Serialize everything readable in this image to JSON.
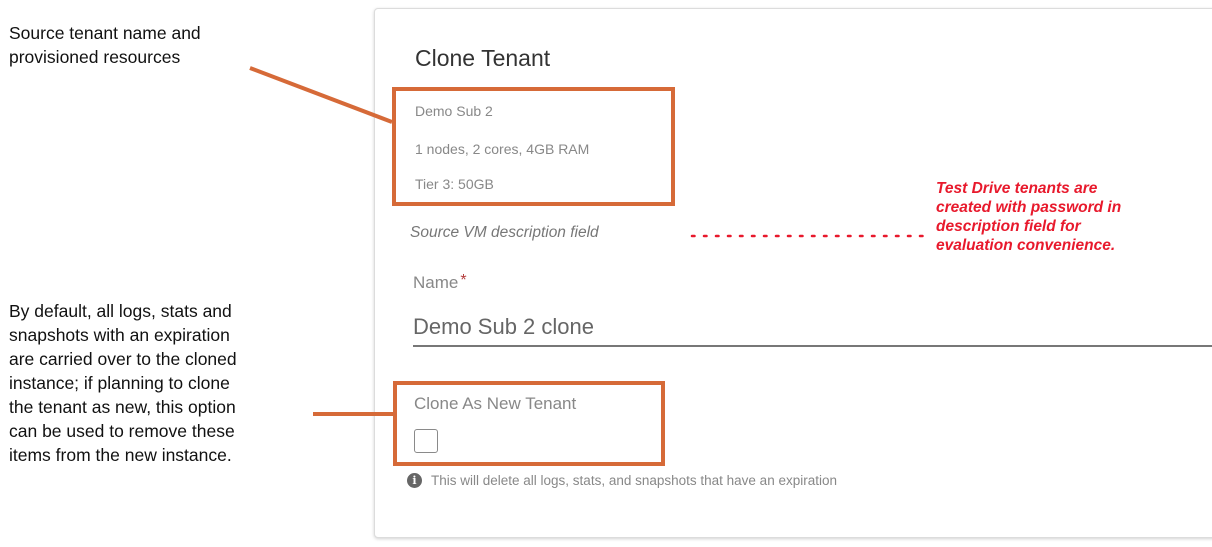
{
  "annotations": {
    "source_label_lines": [
      "Source tenant name and",
      "provisioned resources"
    ],
    "default_note_lines": [
      "By default, all logs, stats and",
      "snapshots with an expiration",
      "are carried over to the cloned",
      "instance; if planning to clone",
      "the tenant as new, this option",
      "can be used to remove these",
      "items from the new instance."
    ],
    "test_drive_note_lines": [
      "Test Drive tenants are",
      "created with password in",
      "description field for",
      "evaluation convenience."
    ]
  },
  "panel": {
    "title": "Clone Tenant",
    "source_name": "Demo Sub 2",
    "resources": "1 nodes, 2 cores, 4GB RAM",
    "storage": "Tier 3: 50GB",
    "description": "Source VM description field",
    "name_label": "Name",
    "name_required_mark": "*",
    "name_value": "Demo Sub 2 clone",
    "clone_new_label": "Clone As New Tenant",
    "clone_new_checked": false,
    "hint_text": "This will delete all logs, stats, and snapshots that have an expiration",
    "info_icon_glyph": "i"
  },
  "colors": {
    "highlight": "#d66a38",
    "red_note": "#e8192c"
  }
}
